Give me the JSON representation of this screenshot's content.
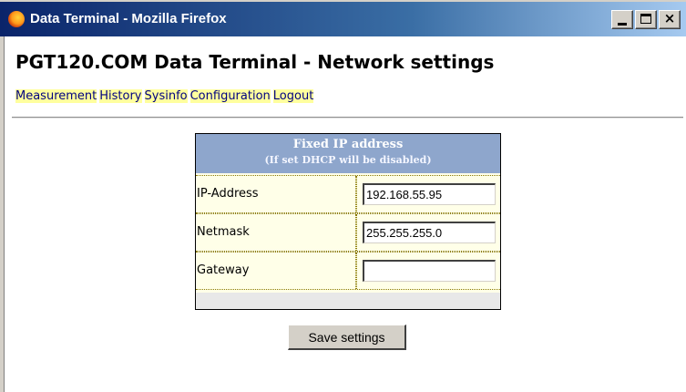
{
  "window": {
    "title": "Data Terminal - Mozilla Firefox",
    "icon": "firefox-logo-icon",
    "buttons": {
      "minimize": "minimize-icon",
      "maximize": "maximize-icon",
      "close": "×"
    }
  },
  "page": {
    "title": "PGT120.COM Data Terminal - Network settings"
  },
  "nav": {
    "items": [
      {
        "label": "Measurement"
      },
      {
        "label": "History"
      },
      {
        "label": "Sysinfo"
      },
      {
        "label": "Configuration"
      },
      {
        "label": "Logout"
      }
    ]
  },
  "form": {
    "heading": "Fixed IP address",
    "subheading": "(If set DHCP will be disabled)",
    "fields": [
      {
        "label": "IP-Address",
        "value": "192.168.55.95"
      },
      {
        "label": "Netmask",
        "value": "255.255.255.0"
      },
      {
        "label": "Gateway",
        "value": ""
      }
    ],
    "save_label": "Save settings"
  },
  "colors": {
    "titlebar": "#0a246a",
    "panel_header": "#8ea6cc",
    "panel_body": "#ffffe8",
    "link_highlight": "#ffff9e",
    "link_text": "#000080"
  }
}
